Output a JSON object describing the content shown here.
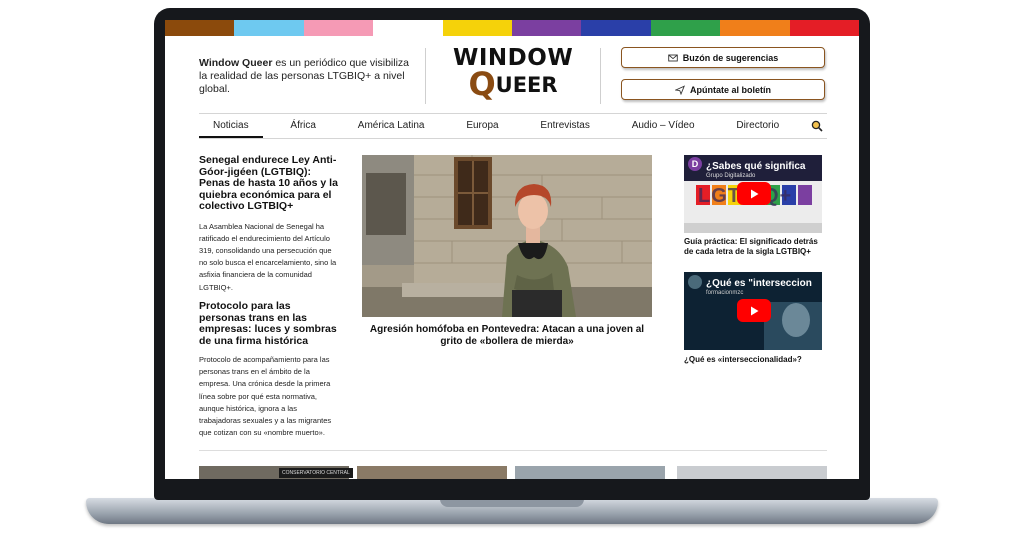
{
  "site": {
    "intro_name": "Window Queer",
    "intro_text": " es un periódico que visibiliza la realidad de las personas LTGBIQ+ a nivel global.",
    "logo_line1": "WINDOW",
    "logo_q": "Q",
    "logo_rest": "UEER"
  },
  "header": {
    "suggestions_label": "Buzón de sugerencias",
    "newsletter_label": "Apúntate al boletín"
  },
  "nav": {
    "items": [
      "Noticias",
      "África",
      "América Latina",
      "Europa",
      "Entrevistas",
      "Audio – Vídeo",
      "Directorio"
    ]
  },
  "articles": [
    {
      "title": "Senegal endurece Ley Anti-Góor-jigéen (LGTBIQ): Penas de hasta 10 años y la quiebra económica para el colectivo LGTBIQ+",
      "summary": "La Asamblea Nacional de Senegal ha ratificado el endurecimiento del Artículo 319, consolidando una persecución que no solo busca el encarcelamiento, sino la asfixia financiera de la comunidad LGTBIQ+."
    },
    {
      "title": "Protocolo para las personas trans en las empresas: luces y sombras de una firma histórica",
      "summary": "Protocolo de acompañamiento para las personas trans en el ámbito de la empresa. Una crónica desde la primera línea sobre por qué esta normativa, aunque histórica, ignora a las trabajadoras sexuales y a las migrantes que cotizan con su «nombre muerto»."
    }
  ],
  "featured": {
    "caption": "Agresión homófoba en Pontevedra: Atacan a una joven al grito de «bollera de mierda»"
  },
  "videos": [
    {
      "title": "¿Sabes qué significa",
      "channel": "Grupo Digitalizado",
      "big_text": "LGTBIQ+",
      "caption": "Guía práctica: El significado detrás de cada letra de la sigla LGTBIQ+"
    },
    {
      "title": "¿Qué es \"interseccion",
      "channel": "formacionmzc",
      "caption": "¿Qué es «interseccionalidad»?"
    }
  ],
  "thumbs": {
    "sign_text": "CONSERVATORIO CENTRAL"
  },
  "colors": {
    "rainbow": [
      "#8b4a0c",
      "#6ec9f0",
      "#f59ab5",
      "#ffffff",
      "#f5d20a",
      "#7b3fa0",
      "#2a3fa8",
      "#2fa04a",
      "#f07f1a",
      "#e41e26"
    ],
    "accent": "#8a4b12",
    "youtube_red": "#ff0000"
  }
}
